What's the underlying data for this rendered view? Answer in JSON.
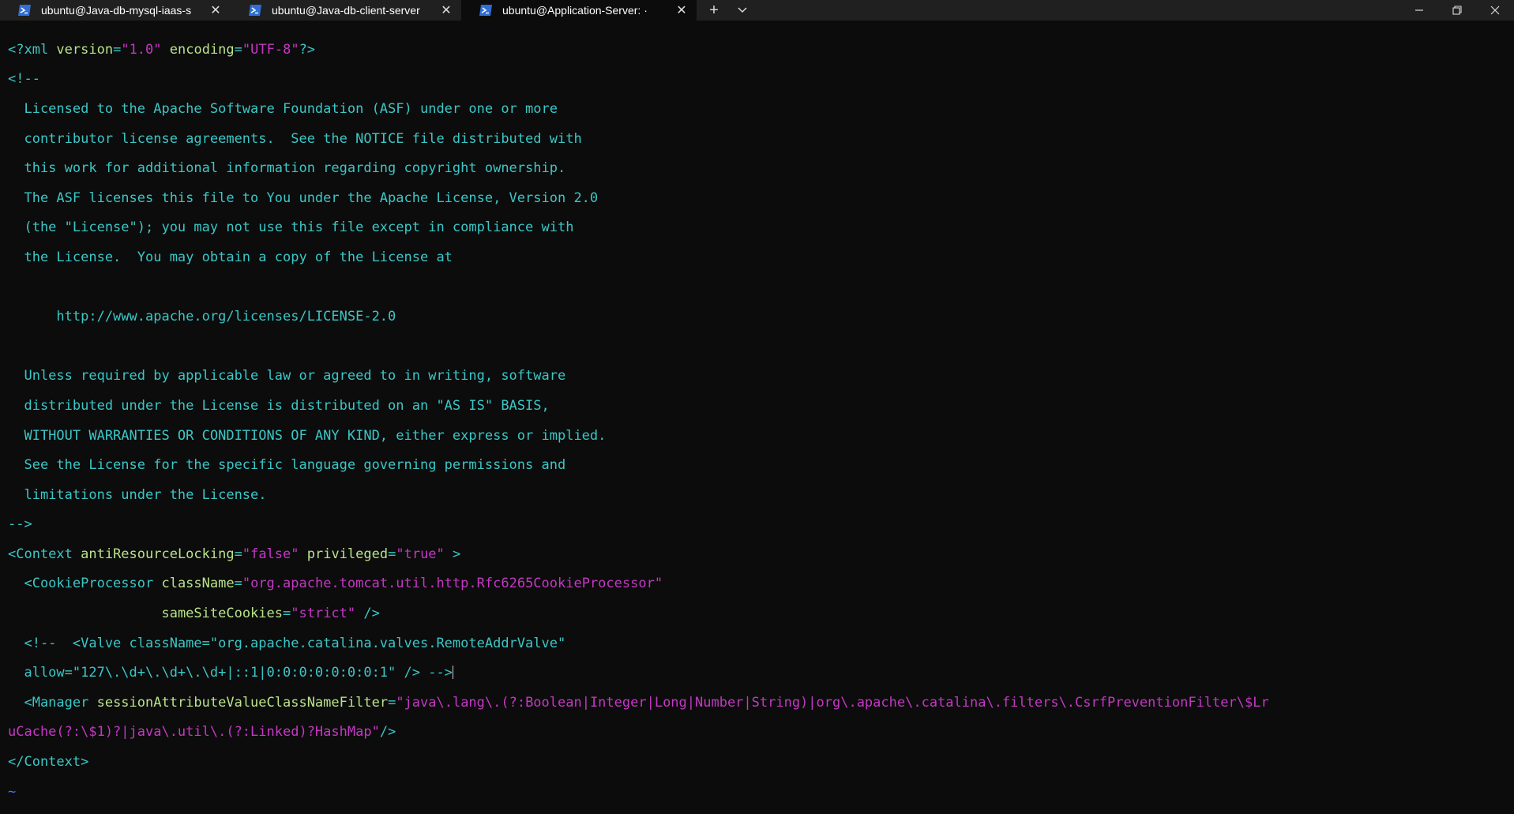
{
  "tabs": [
    {
      "title": "ubuntu@Java-db-mysql-iaas-s",
      "close": "✕",
      "icon": "powershell-icon"
    },
    {
      "title": "ubuntu@Java-db-client-server",
      "close": "✕",
      "icon": "powershell-icon"
    },
    {
      "title": "ubuntu@Application-Server: ·",
      "close": "✕",
      "icon": "powershell-icon",
      "active": true
    }
  ],
  "tabbar": {
    "new_tab": "+",
    "dropdown": "⌄"
  },
  "window": {
    "minimize": "─",
    "maximize": "❐",
    "close": "✕"
  },
  "file": {
    "xml_decl_open": "<?xml ",
    "xml_decl_attr1": "version",
    "xml_decl_val1": "\"1.0\"",
    "xml_decl_attr2": "encoding",
    "xml_decl_val2": "\"UTF-8\"",
    "xml_decl_close": "?>",
    "comment_open": "<!--",
    "license": [
      "  Licensed to the Apache Software Foundation (ASF) under one or more",
      "  contributor license agreements.  See the NOTICE file distributed with",
      "  this work for additional information regarding copyright ownership.",
      "  The ASF licenses this file to You under the Apache License, Version 2.0",
      "  (the \"License\"); you may not use this file except in compliance with",
      "  the License.  You may obtain a copy of the License at",
      "",
      "      http://www.apache.org/licenses/LICENSE-2.0",
      "",
      "  Unless required by applicable law or agreed to in writing, software",
      "  distributed under the License is distributed on an \"AS IS\" BASIS,",
      "  WITHOUT WARRANTIES OR CONDITIONS OF ANY KIND, either express or implied.",
      "  See the License for the specific language governing permissions and",
      "  limitations under the License."
    ],
    "comment_close": "-->",
    "context_open": "<Context ",
    "context_attr1": "antiResourceLocking",
    "context_val1": "\"false\"",
    "context_attr2": "privileged",
    "context_val2": "\"true\"",
    "context_end": " >",
    "cookie_tag": "  <CookieProcessor ",
    "cookie_attr1": "className",
    "cookie_val1": "\"org.apache.tomcat.util.http.Rfc6265CookieProcessor\"",
    "cookie_indent": "                   ",
    "cookie_attr2": "sameSiteCookies",
    "cookie_val2": "\"strict\"",
    "cookie_close": " />",
    "valve_line1": "  <!--  <Valve className=\"org.apache.catalina.valves.RemoteAddrValve\"",
    "valve_line2": "  allow=\"127\\.\\d+\\.\\d+\\.\\d+|::1|0:0:0:0:0:0:0:1\" /> -->",
    "manager_tag": "  <Manager ",
    "manager_attr": "sessionAttributeValueClassNameFilter",
    "manager_val1": "\"java\\.lang\\.(?:Boolean|Integer|Long|Number|String)|org\\.apache\\.catalina\\.filters\\.CsrfPreventionFilter\\$Lr",
    "manager_val2": "uCache(?:\\$1)?|java\\.util\\.(?:Linked)?HashMap\"",
    "manager_close": "/>",
    "context_close": "</Context>",
    "tilde": "~"
  }
}
